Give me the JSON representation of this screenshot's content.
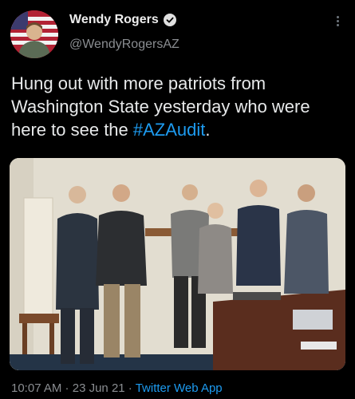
{
  "user": {
    "display_name": "Wendy Rogers",
    "handle": "@WendyRogersAZ"
  },
  "tweet": {
    "text_before": "Hung out with more patriots from Washington State yesterday who were here to see the ",
    "hashtag": "#AZAudit",
    "text_after": "."
  },
  "meta": {
    "time": "10:07 AM",
    "sep1": " · ",
    "date": "23 Jun 21",
    "sep2": " · ",
    "app": "Twitter Web App"
  },
  "icons": {
    "verified": "verified-badge-icon",
    "more": "more-options-icon"
  },
  "colors": {
    "background": "#000000",
    "link": "#1d9bf0",
    "secondary_text": "#8a8d91"
  }
}
